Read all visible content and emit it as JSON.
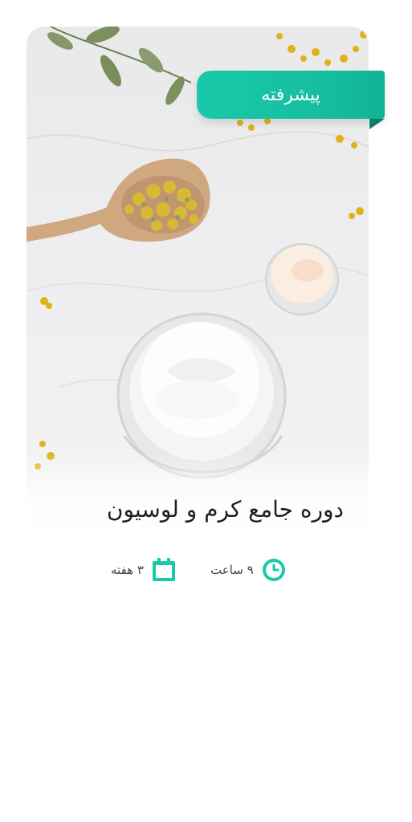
{
  "course_card": {
    "level_badge": "پیشرفته",
    "title": "دوره جامع کرم و لوسیون",
    "duration_hours": "۹ ساعت",
    "duration_weeks": "۳ هفته"
  },
  "icons": {
    "hours": "clock-icon",
    "weeks": "calendar-icon"
  },
  "colors": {
    "accent": "#19c9a9",
    "accent_dark": "#0c7d68",
    "title_text": "#1f1f1f",
    "meta_text": "#444444"
  }
}
